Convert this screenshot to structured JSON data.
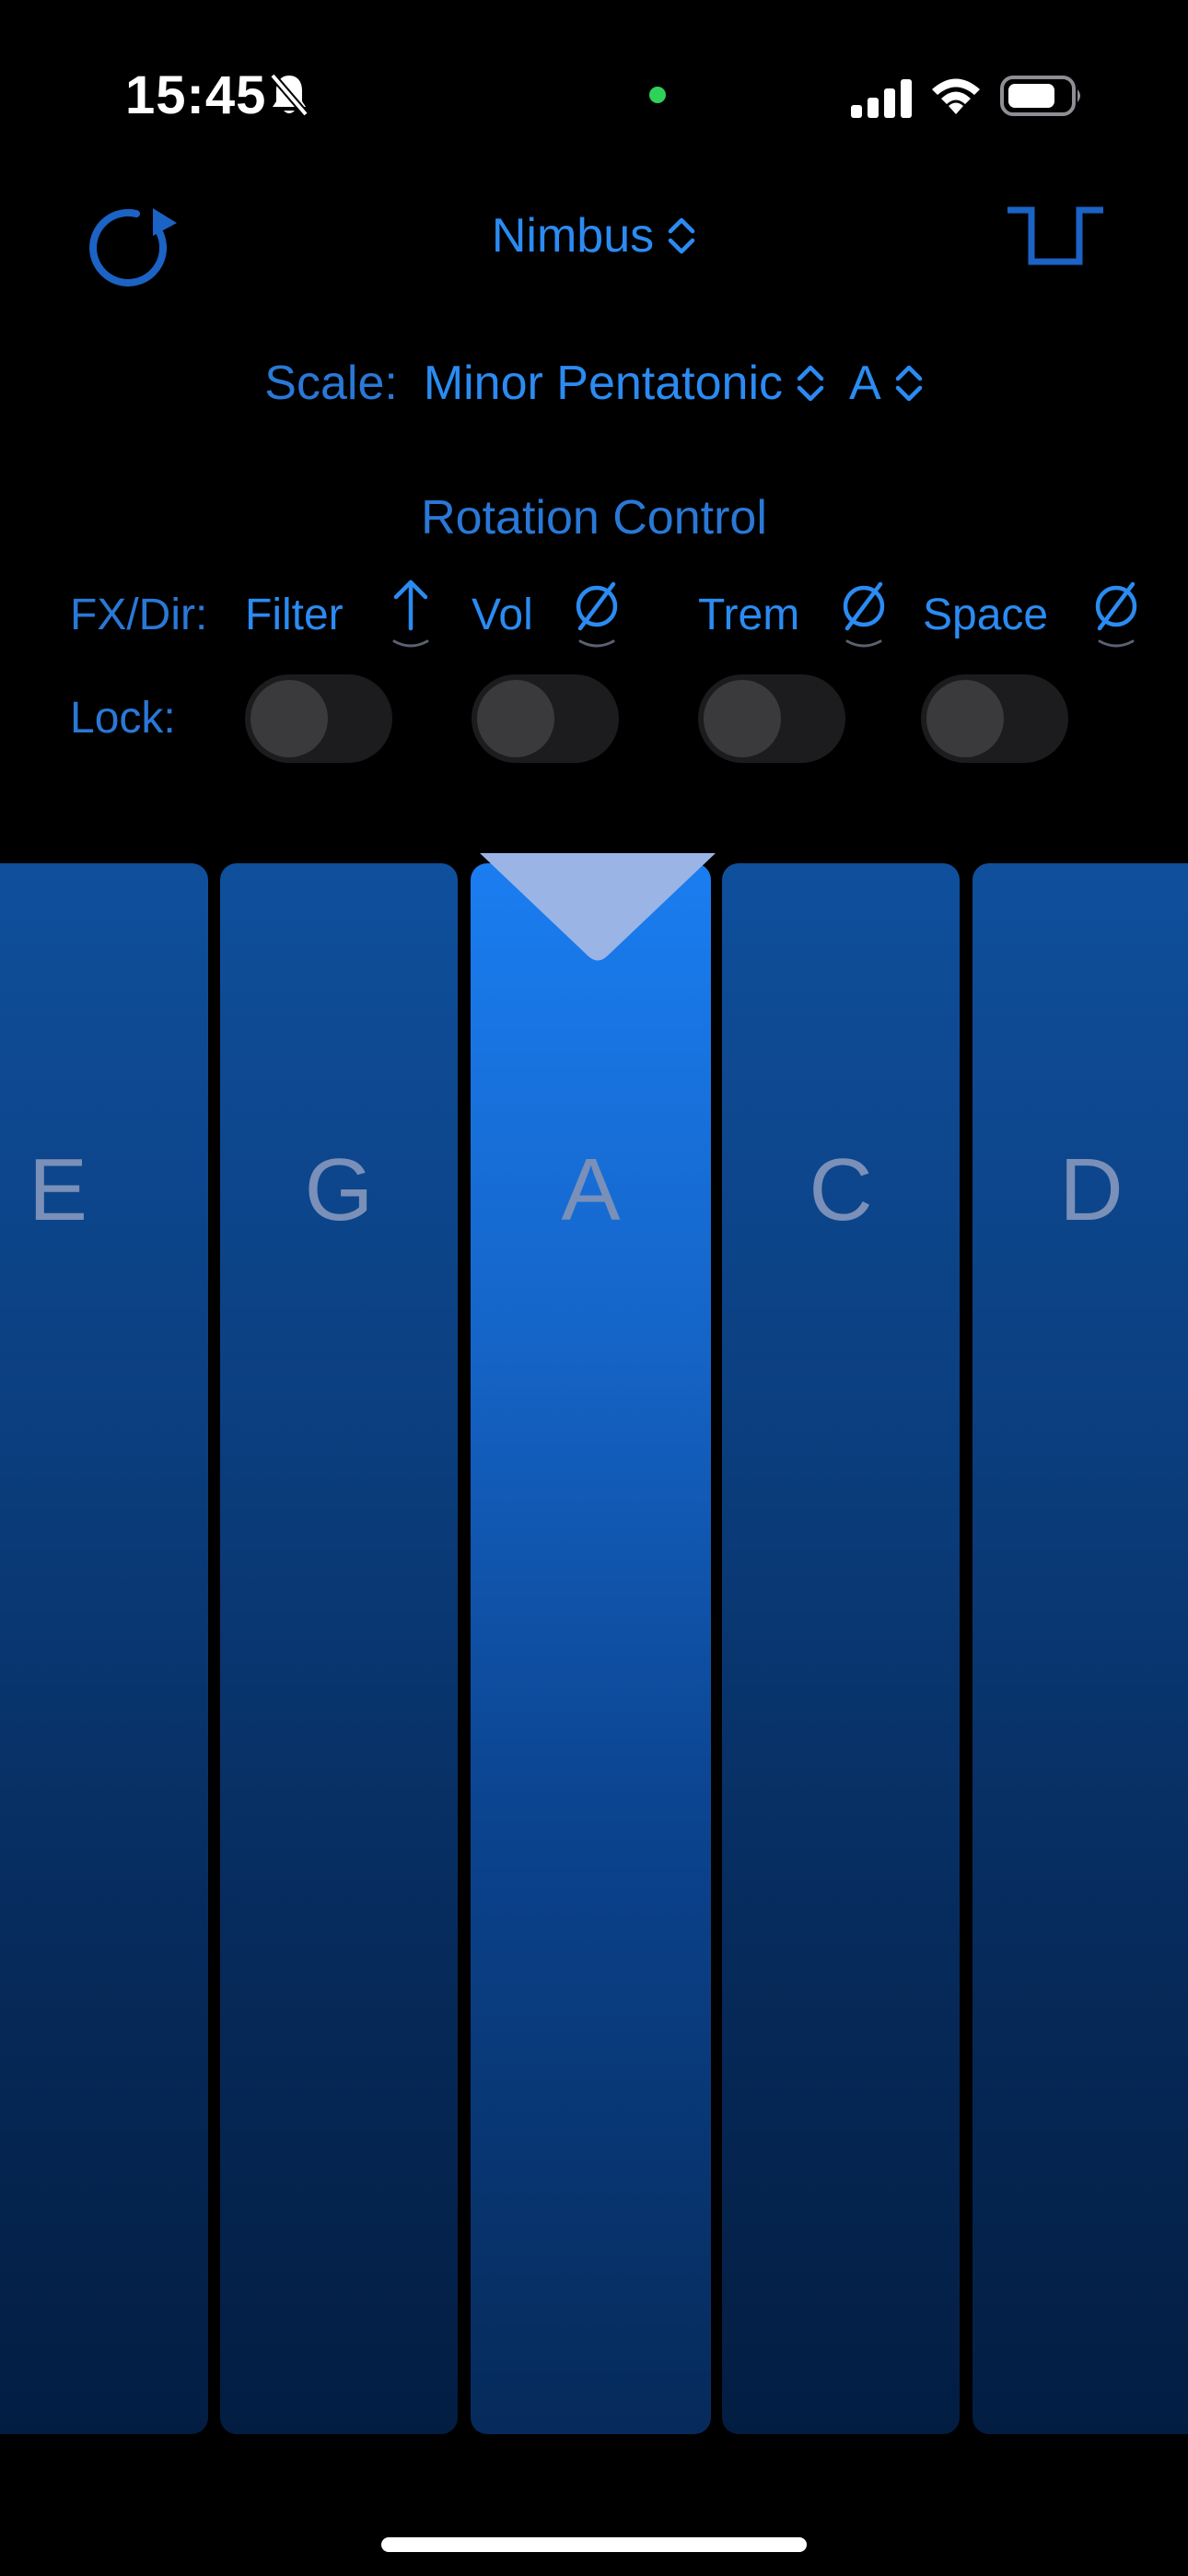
{
  "status_bar": {
    "time": "15:45",
    "mute_icon": "bell-slash-icon",
    "privacy_dot_color": "#2fd158",
    "icons": [
      "cellular-signal-icon",
      "wifi-icon",
      "battery-icon"
    ]
  },
  "toolbar": {
    "refresh_icon": "refresh-icon",
    "preset_name": "Nimbus",
    "preset_chevron_icon": "chevron-up-down-icon",
    "waveform_icon": "square-wave-icon"
  },
  "scale": {
    "label": "Scale:",
    "value": "Minor Pentatonic",
    "key": "A"
  },
  "rotation_control": {
    "title": "Rotation Control",
    "fx_label": "FX/Dir:",
    "lock_label": "Lock:",
    "effects": [
      {
        "name": "Filter",
        "direction_icon": "arrow-up-icon",
        "locked": false
      },
      {
        "name": "Vol",
        "direction_icon": "empty-set-icon",
        "locked": false
      },
      {
        "name": "Trem",
        "direction_icon": "empty-set-icon",
        "locked": false
      },
      {
        "name": "Space",
        "direction_icon": "empty-set-icon",
        "locked": false
      }
    ]
  },
  "keys": [
    {
      "note": "E",
      "active": false
    },
    {
      "note": "G",
      "active": false
    },
    {
      "note": "A",
      "active": true
    },
    {
      "note": "C",
      "active": false
    },
    {
      "note": "D",
      "active": false
    }
  ],
  "colors": {
    "accent": "#2b8bf2",
    "label": "#2a78d6",
    "key_top": "#0f4f9c",
    "key_active_top": "#1a7df0",
    "pointer": "#9ab4e6"
  }
}
